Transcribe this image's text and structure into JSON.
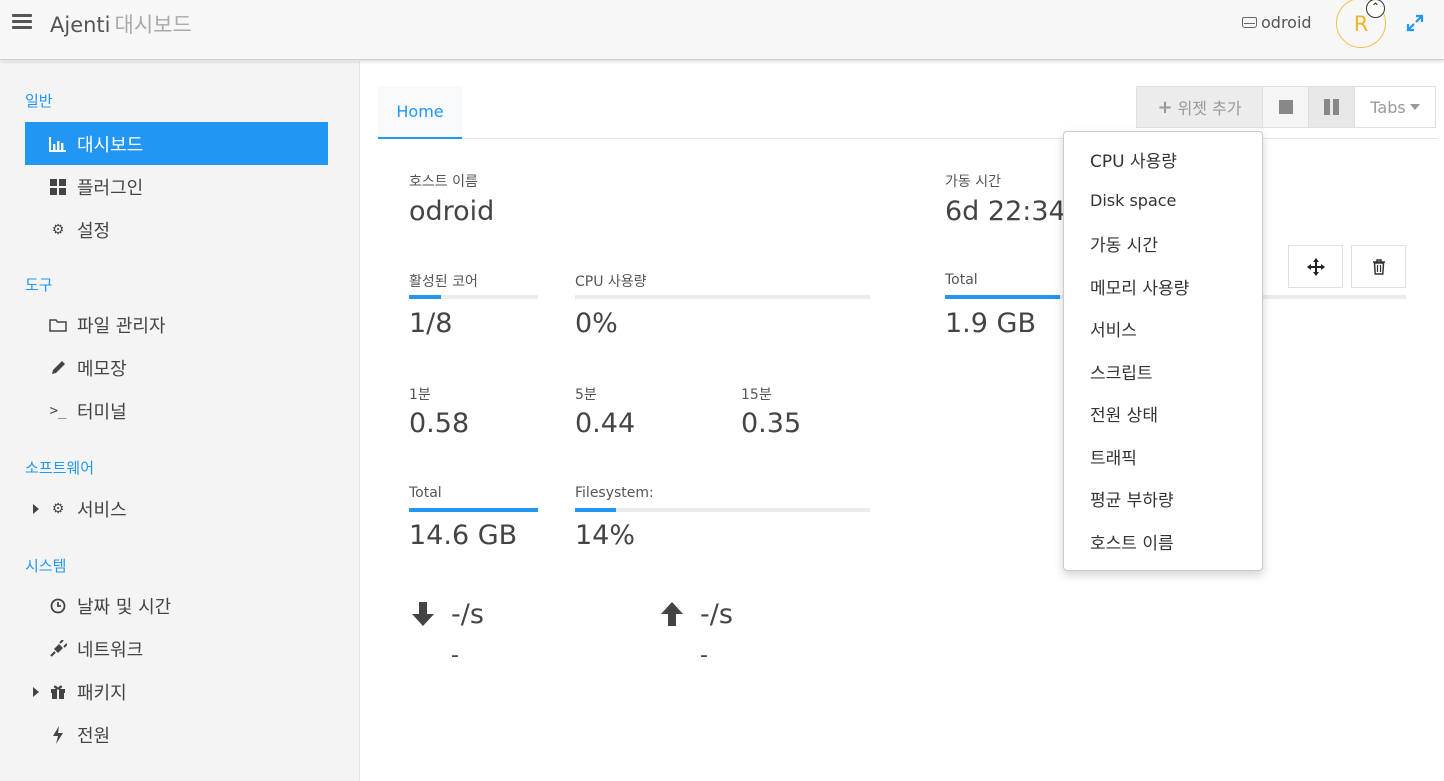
{
  "header": {
    "app_name": "Ajenti",
    "app_subtitle": "대시보드",
    "host": "odroid",
    "avatar_letter": "R"
  },
  "sidebar": {
    "sections": [
      {
        "title": "일반",
        "items": [
          {
            "label": "대시보드",
            "icon": "bar-chart-icon",
            "active": true
          },
          {
            "label": "플러그인",
            "icon": "grid-icon"
          },
          {
            "label": "설정",
            "icon": "gear-icon"
          }
        ]
      },
      {
        "title": "도구",
        "items": [
          {
            "label": "파일 관리자",
            "icon": "folder-icon"
          },
          {
            "label": "메모장",
            "icon": "pencil-icon"
          },
          {
            "label": "터미널",
            "icon": "terminal-icon"
          }
        ]
      },
      {
        "title": "소프트웨어",
        "items": [
          {
            "label": "서비스",
            "icon": "gears-icon",
            "expandable": true
          }
        ]
      },
      {
        "title": "시스템",
        "items": [
          {
            "label": "날짜 및 시간",
            "icon": "clock-icon"
          },
          {
            "label": "네트워크",
            "icon": "plug-icon"
          },
          {
            "label": "패키지",
            "icon": "gift-icon",
            "expandable": true
          },
          {
            "label": "전원",
            "icon": "bolt-icon"
          }
        ]
      }
    ]
  },
  "tabs": {
    "home": "Home"
  },
  "toolbar": {
    "add_widget": "위젯 추가",
    "tabs": "Tabs"
  },
  "widgets": {
    "hostname": {
      "label": "호스트 이름",
      "value": "odroid"
    },
    "uptime": {
      "label": "가동 시간",
      "value": "6d 22:34:"
    },
    "cores": {
      "label": "활성된 코어",
      "value": "1/8",
      "fill": 0.25
    },
    "cpu": {
      "label": "CPU 사용량",
      "value": "0%",
      "fill": 0.0
    },
    "memory": {
      "label": "Total",
      "value": "1.9 GB",
      "fill": 0.25
    },
    "load": [
      {
        "label": "1분",
        "value": "0.58"
      },
      {
        "label": "5분",
        "value": "0.44"
      },
      {
        "label": "15분",
        "value": "0.35"
      }
    ],
    "disk_total": {
      "label": "Total",
      "value": "14.6 GB",
      "fill": 1.0
    },
    "filesystem": {
      "label": "Filesystem:",
      "value": "14%",
      "fill": 0.14
    },
    "traffic_down": {
      "rate": "-/s",
      "total": "-"
    },
    "traffic_up": {
      "rate": "-/s",
      "total": "-"
    }
  },
  "dropdown": {
    "items": [
      "CPU 사용량",
      "Disk space",
      "가동 시간",
      "메모리 사용량",
      "서비스",
      "스크립트",
      "전원 상태",
      "트래픽",
      "평균 부하량",
      "호스트 이름"
    ]
  },
  "colors": {
    "accent": "#2196f3",
    "avatar": "#f0b428"
  }
}
